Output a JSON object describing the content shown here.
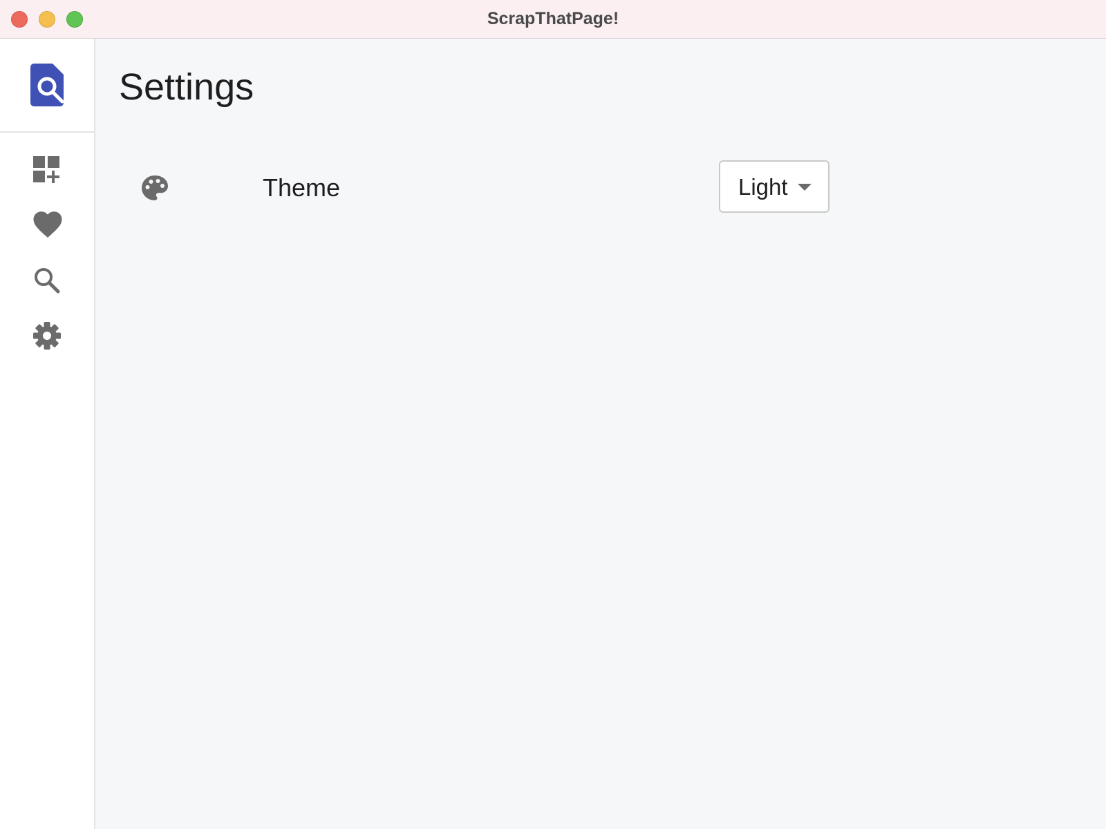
{
  "window": {
    "title": "ScrapThatPage!"
  },
  "sidebar": {
    "logo_icon": "document-search-icon",
    "items": [
      {
        "name": "add-widget",
        "icon": "dashboard-add-icon"
      },
      {
        "name": "favorites",
        "icon": "heart-icon"
      },
      {
        "name": "search",
        "icon": "search-icon"
      },
      {
        "name": "settings",
        "icon": "gear-icon"
      }
    ]
  },
  "page": {
    "title": "Settings"
  },
  "settings": {
    "theme": {
      "icon": "palette-icon",
      "label": "Theme",
      "value": "Light"
    }
  },
  "colors": {
    "brand": "#3f51b5",
    "icon_gray": "#6b6b6b",
    "titlebar_bg": "#fbeff2",
    "content_bg": "#f6f7f9"
  }
}
